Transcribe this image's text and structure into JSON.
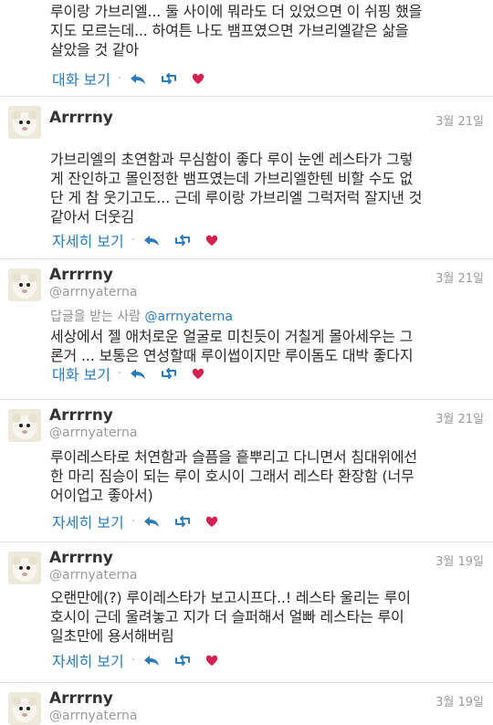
{
  "colors": {
    "link": "#2b7bb9",
    "heart": "#d6204f",
    "muted": "#9a9a9a",
    "divider": "#e3e3e3"
  },
  "tweets": [
    {
      "body": "루이랑 가브리엘... 둘 사이에 뭐라도 더 있었으면 이 쉬핑 했을\n지도 모르는데... 하여튼 나도 뱀프였으면 가브리엘같은 삶을\n살았을 것 같아",
      "action_link": "대화 보기"
    },
    {
      "name": "Arrrrny",
      "date": "3월 21일",
      "body": "가브리엘의 초연함과 무심함이 좋다 루이 눈엔 레스타가 그렇\n게 잔인하고 몰인정한 뱀프였는데 가브리엘한텐 비할 수도 없\n단 게 참 웃기고도... 근데 루이랑 가브리엘 그럭저럭 잘지낸 것\n같아서 더웃김",
      "action_link": "자세히 보기"
    },
    {
      "name": "Arrrrny",
      "handle": "@arrnyaterna",
      "date": "3월 21일",
      "reply_prefix": "답글을 받는 사람",
      "reply_mention": "@arrnyaterna",
      "body": "세상에서 젤 애처로운 얼굴로 미친듯이 거칠게 몰아세우는 그\n론거 ... 보통은 연성할때 루이썹이지만 루이돔도 대박 좋다지",
      "action_link": "대화 보기"
    },
    {
      "name": "Arrrrny",
      "handle": "@arrnyaterna",
      "date": "3월 21일",
      "body": "루이레스타로 처연함과 슬픔을 흩뿌리고 다니면서 침대위에선\n한 마리 짐승이 되는 루이 호시이 그래서 레스타 환장함 (너무\n어이업고 좋아서)",
      "action_link": "자세히 보기"
    },
    {
      "name": "Arrrrny",
      "handle": "@arrnyaterna",
      "date": "3월 19일",
      "body": "오랜만에(?) 루이레스타가 보고시프다..! 레스타 울리는 루이\n호시이 근데 울려놓고 지가 더 슬퍼해서 얼빠 레스타는 루이\n일초만에 용서해버림",
      "action_link": "자세히 보기"
    },
    {
      "name": "Arrrrny",
      "handle": "@arrnyaterna",
      "date": "3월 19일"
    }
  ]
}
